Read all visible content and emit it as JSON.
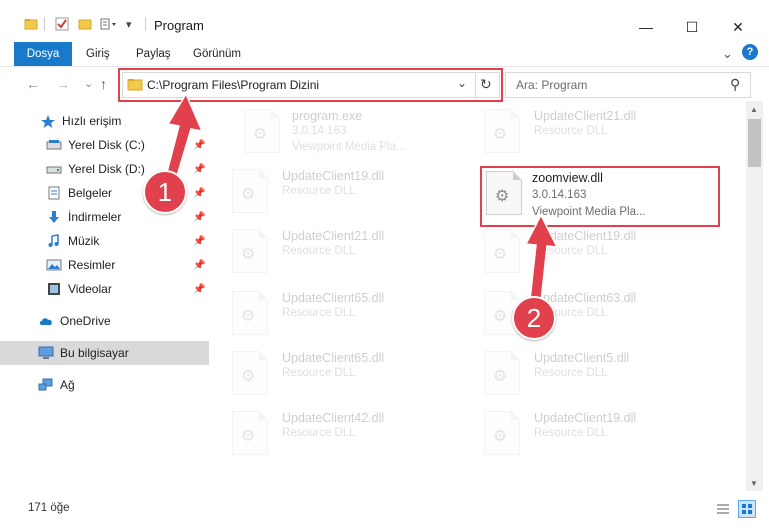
{
  "window": {
    "title": "Program",
    "minimize_glyph": "—",
    "maximize_glyph": "☐",
    "close_glyph": "✕"
  },
  "ribbon": {
    "tabs": [
      {
        "label": "Dosya"
      },
      {
        "label": "Giriş"
      },
      {
        "label": "Paylaş"
      },
      {
        "label": "Görünüm"
      }
    ],
    "expand_glyph": "⌄",
    "help_glyph": "?"
  },
  "nav": {
    "back_glyph": "←",
    "forward_glyph": "→",
    "recent_glyph": "⌄",
    "up_glyph": "↑",
    "address": "C:\\Program Files\\Program Dizini",
    "address_dropdown_glyph": "⌄",
    "refresh_glyph": "↻",
    "search_placeholder": "Ara: Program",
    "search_glyph": "⚲"
  },
  "sidebar": {
    "pin_glyph": "📌",
    "items": [
      {
        "label": "Hızlı erişim",
        "icon": "star-icon"
      },
      {
        "label": "Yerel Disk (C:)",
        "icon": "drive-icon"
      },
      {
        "label": "Yerel Disk (D:)",
        "icon": "drive-icon"
      },
      {
        "label": "Belgeler",
        "icon": "documents-icon"
      },
      {
        "label": "İndirmeler",
        "icon": "download-icon"
      },
      {
        "label": "Müzik",
        "icon": "music-icon"
      },
      {
        "label": "Resimler",
        "icon": "pictures-icon"
      },
      {
        "label": "Videolar",
        "icon": "videos-icon"
      },
      {
        "label": "OneDrive",
        "icon": "cloud-icon"
      },
      {
        "label": "Bu bilgisayar",
        "icon": "computer-icon"
      },
      {
        "label": "Ağ",
        "icon": "network-icon"
      }
    ]
  },
  "files": [
    {
      "name": "program.exe",
      "line1": "3.0.14.163",
      "line2": "Viewpoint Media Pla..."
    },
    {
      "name": "UpdateClient21.dll",
      "line1": "Resource DLL"
    },
    {
      "name": "UpdateClient19.dll",
      "line1": "Resource DLL"
    },
    {
      "name": "zoomview.dll",
      "line1": "3.0.14.163",
      "line2": "Viewpoint Media Pla..."
    },
    {
      "name": "UpdateClient21.dll",
      "line1": "Resource DLL"
    },
    {
      "name": "UpdateClient19.dll",
      "line1": "Resource DLL"
    },
    {
      "name": "UpdateClient65.dll",
      "line1": "Resource DLL"
    },
    {
      "name": "UpdateClient63.dll",
      "line1": "Resource DLL"
    },
    {
      "name": "UpdateClient65.dll",
      "line1": "Resource DLL"
    },
    {
      "name": "UpdateClient5.dll",
      "line1": "Resource DLL"
    },
    {
      "name": "UpdateClient42.dll",
      "line1": "Resource DLL"
    },
    {
      "name": "UpdateClient19.dll",
      "line1": "Resource DLL"
    }
  ],
  "status": {
    "count": "171 öğe"
  },
  "annotations": {
    "step1": "1",
    "step2": "2",
    "color": "#e0414d"
  },
  "colors": {
    "accent": "#1979ca",
    "selection": "#d9d9d9"
  }
}
